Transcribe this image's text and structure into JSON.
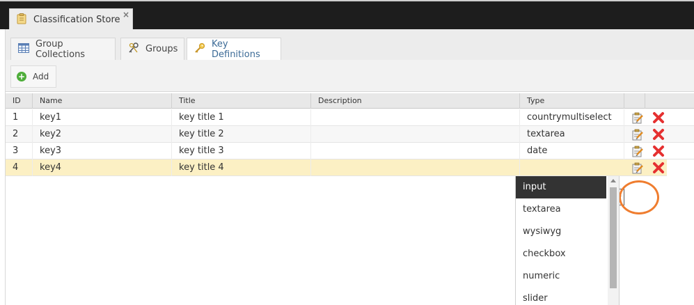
{
  "top_tab": {
    "title": "Classification Store",
    "close": "×"
  },
  "sub_tabs": [
    {
      "label": "Group Collections"
    },
    {
      "label": "Groups"
    },
    {
      "label": "Key Definitions"
    }
  ],
  "toolbar": {
    "add_label": "Add",
    "add_glyph": "+"
  },
  "grid": {
    "columns": [
      "ID",
      "Name",
      "Title",
      "Description",
      "Type"
    ],
    "rows": [
      {
        "id": "1",
        "name": "key1",
        "title": "key title 1",
        "description": "",
        "type": "countrymultiselect"
      },
      {
        "id": "2",
        "name": "key2",
        "title": "key title 2",
        "description": "",
        "type": "textarea"
      },
      {
        "id": "3",
        "name": "key3",
        "title": "key title 3",
        "description": "",
        "type": "date"
      },
      {
        "id": "4",
        "name": "key4",
        "title": "key title 4",
        "description": "",
        "type": ""
      }
    ],
    "selected_row_index": 3
  },
  "type_editor": {
    "value": "input",
    "options": [
      "input",
      "textarea",
      "wysiwyg",
      "checkbox",
      "numeric",
      "slider"
    ],
    "selected_option": "input"
  },
  "colors": {
    "accent_tab_text": "#3b6a96",
    "selected_row": "#fcf0c4",
    "highlight_ring": "#ef7d2f",
    "delete_icon": "#e53030",
    "add_icon": "#4fae3b"
  }
}
